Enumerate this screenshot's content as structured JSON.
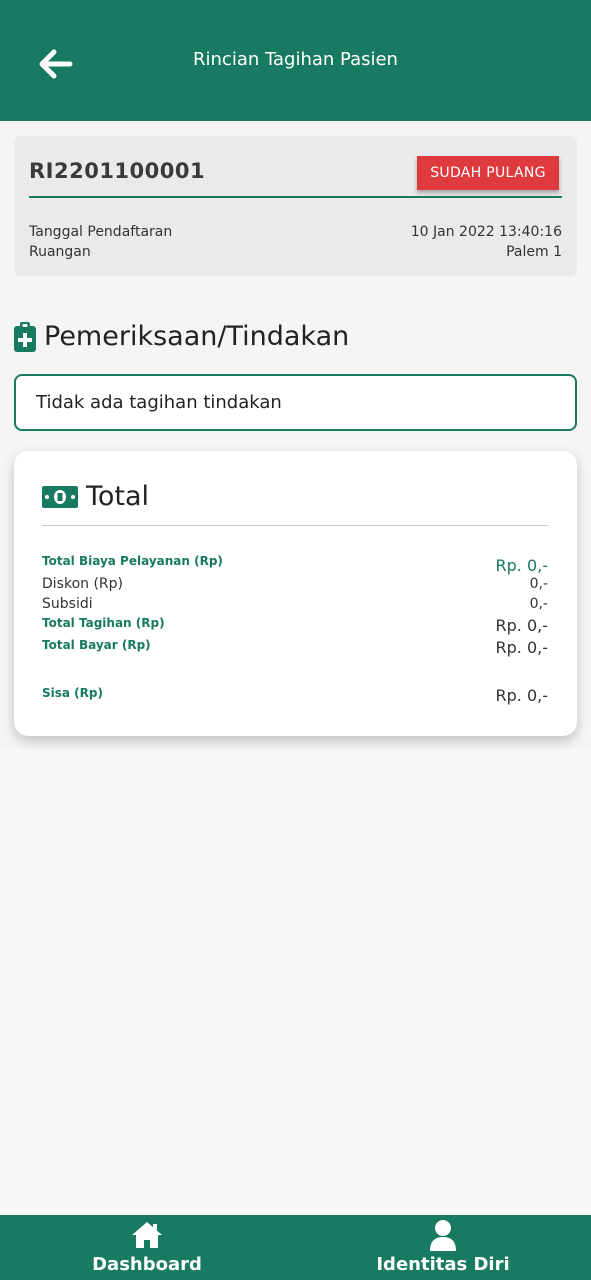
{
  "header": {
    "title": "Rincian Tagihan Pasien",
    "back_icon": "arrow-left-icon",
    "background": "#187a60"
  },
  "registration": {
    "number": "RI2201100001",
    "status": "SUDAH PULANG",
    "status_color": "#df3b3e",
    "rows": [
      {
        "label": "Tanggal Pendaftaran",
        "value": "10 Jan 2022 13:40:16"
      },
      {
        "label": "Ruangan",
        "value": "Palem 1"
      }
    ]
  },
  "procedures": {
    "icon": "clipboard-plus-icon",
    "title": "Pemeriksaan/Tindakan",
    "empty_message": "Tidak ada tagihan tindakan"
  },
  "total": {
    "icon": "money-bill-icon",
    "title": "Total",
    "rows": [
      {
        "label": "Total Biaya Pelayanan (Rp)",
        "value": "Rp. 0,-"
      },
      {
        "label": "Diskon (Rp)",
        "value": "0,-"
      },
      {
        "label": "Subsidi",
        "value": "0,-"
      },
      {
        "label": "Total Tagihan (Rp)",
        "value": "Rp. 0,-"
      },
      {
        "label": "Total Bayar (Rp)",
        "value": "Rp. 0,-"
      },
      {
        "label": "Sisa (Rp)",
        "value": "Rp. 0,-"
      }
    ]
  },
  "bottom_nav": {
    "items": [
      {
        "label": "Dashboard",
        "icon": "home-icon"
      },
      {
        "label": "Identitas Diri",
        "icon": "user-icon"
      }
    ]
  },
  "colors": {
    "primary": "#187a60",
    "danger": "#df3b3e",
    "background": "#f8f8f8"
  }
}
